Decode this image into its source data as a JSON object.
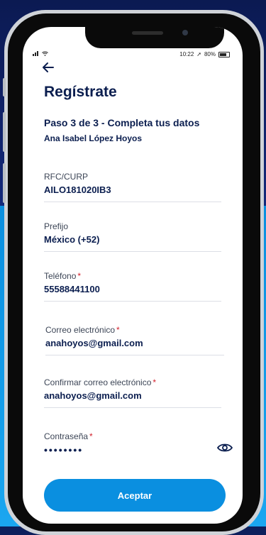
{
  "status_bar": {
    "time": "10:22",
    "location_glyph": "➚",
    "battery_percent": "80%"
  },
  "header": {
    "title": "Regístrate",
    "step": "Paso 3 de 3 - Completa tus datos",
    "user_name": "Ana Isabel López Hoyos"
  },
  "form": {
    "required_mark": "*",
    "rfc": {
      "label": "RFC/CURP",
      "value": "AILO181020IB3"
    },
    "prefix": {
      "label": "Prefijo",
      "value": "México (+52)"
    },
    "phone": {
      "label": "Teléfono",
      "value": "55588441100"
    },
    "email": {
      "label": "Correo electrónico",
      "value": "anahoyos@gmail.com"
    },
    "email_confirm": {
      "label": "Confirmar correo electrónico",
      "value": "anahoyos@gmail.com"
    },
    "password": {
      "label": "Contraseña",
      "value": "••••••••"
    }
  },
  "actions": {
    "accept_label": "Aceptar"
  },
  "icons": {
    "back": "arrow-left-icon",
    "password_toggle": "eye-icon"
  },
  "colors": {
    "primary_blue": "#0a8fe0",
    "navy_text": "#0b1e4f",
    "required_red": "#d21f2b"
  }
}
